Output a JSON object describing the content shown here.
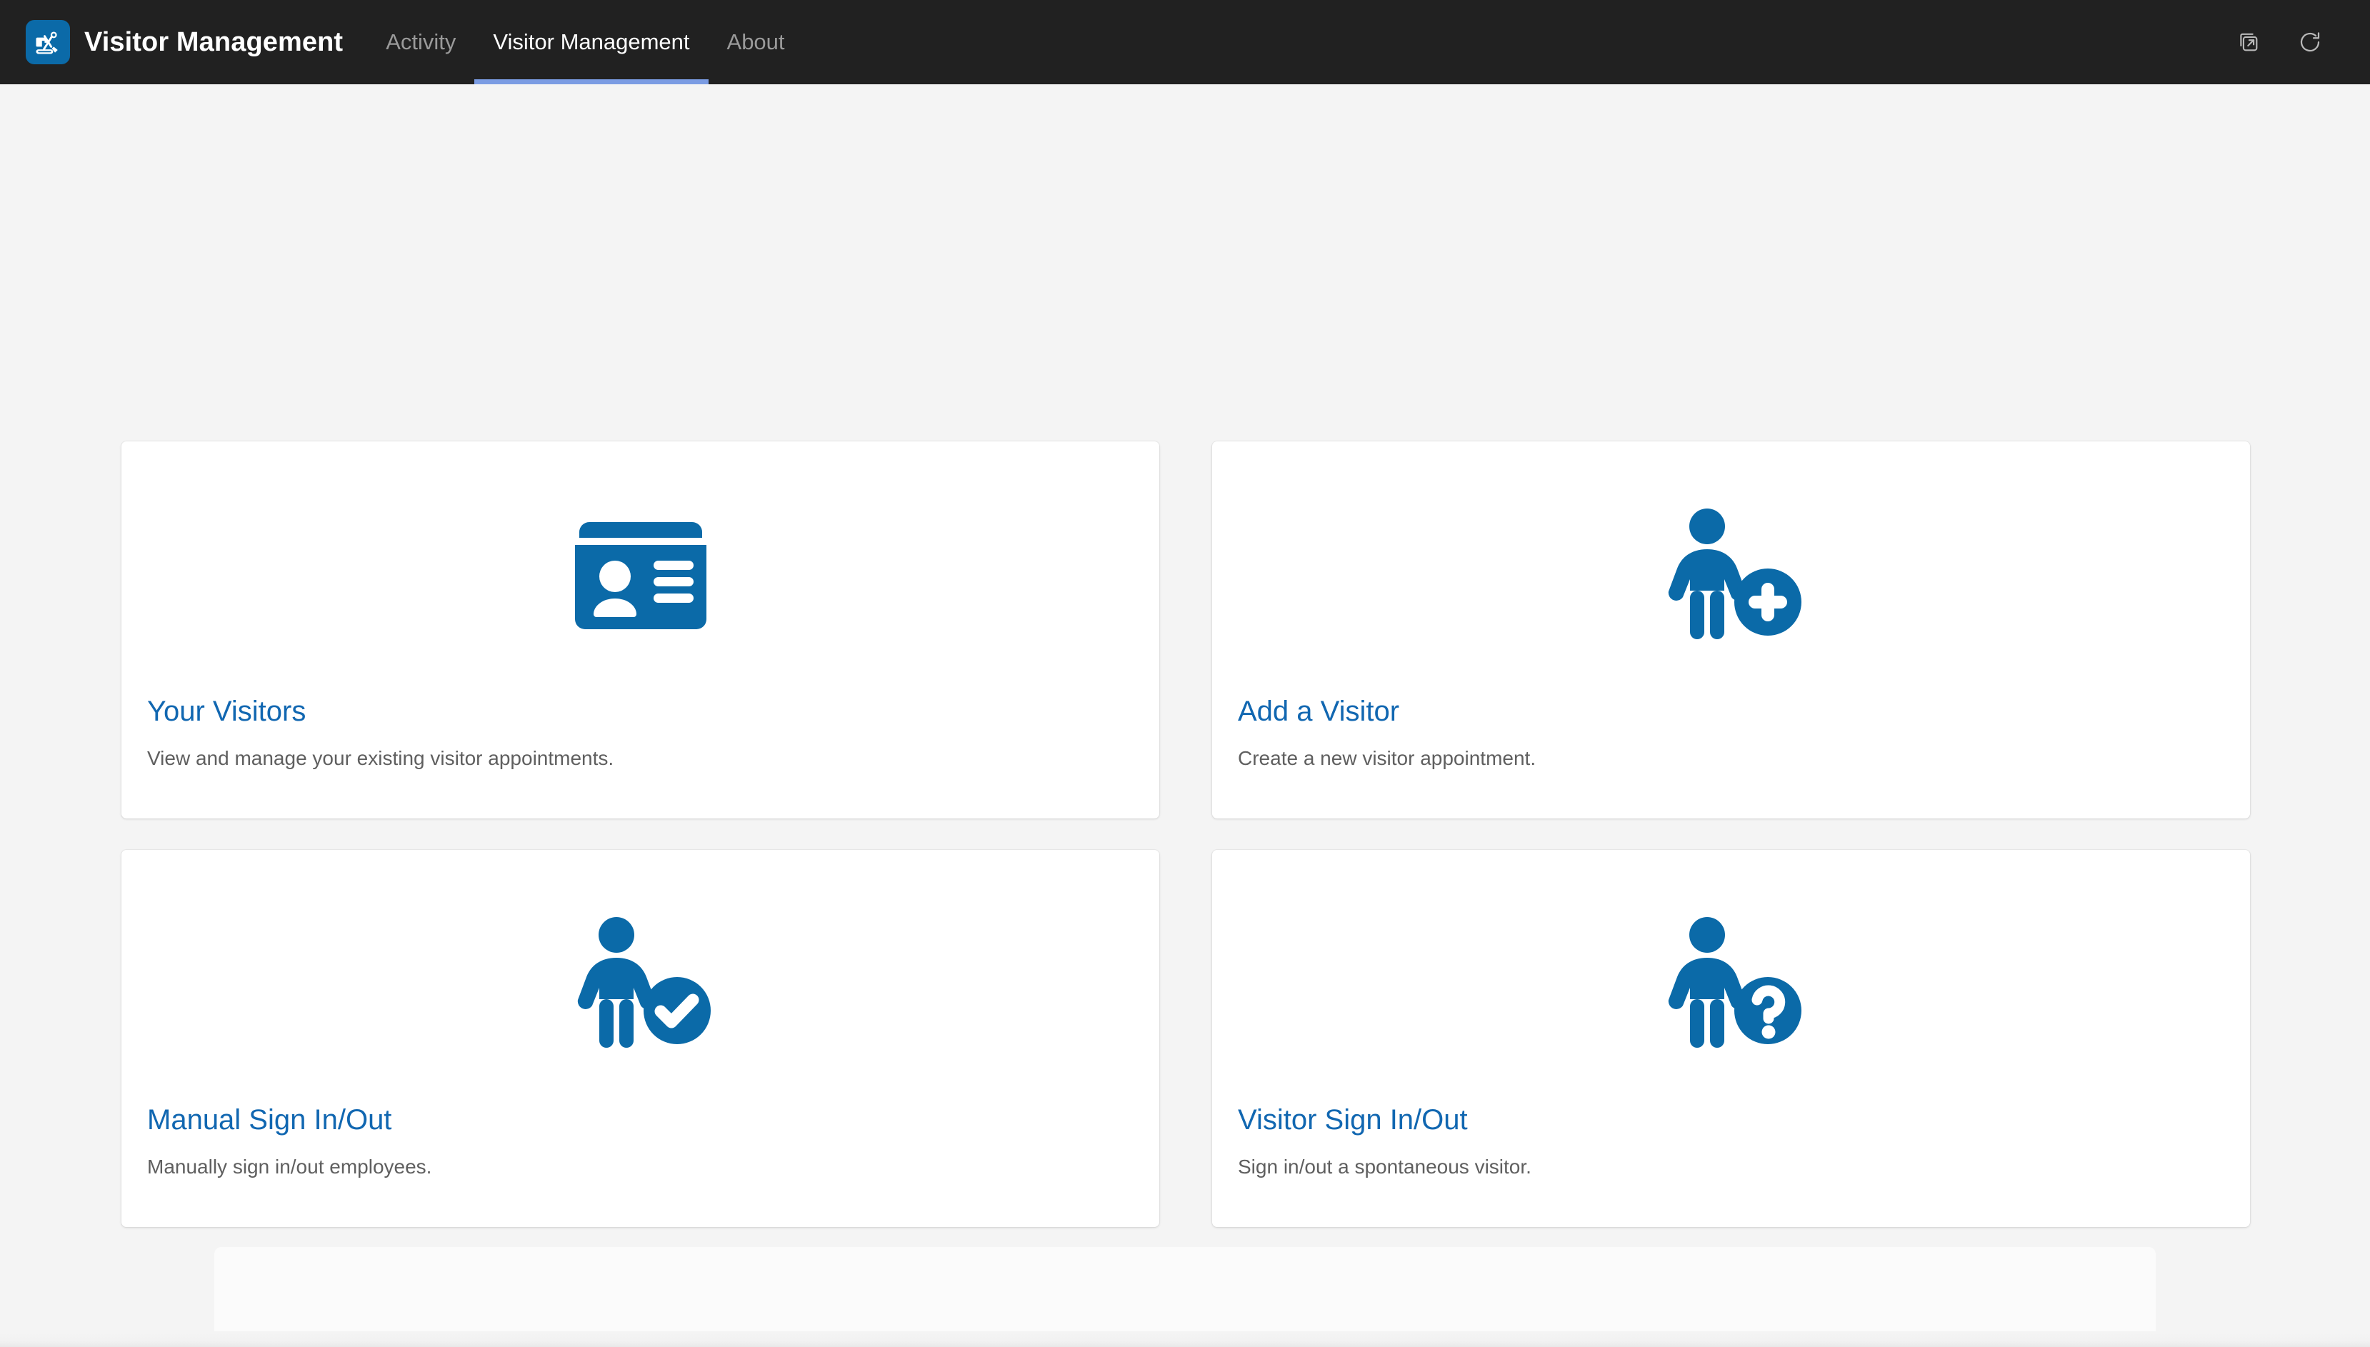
{
  "navbar": {
    "logo_icon": "excavator-tools-logo-icon",
    "brand_title": "Visitor Management",
    "items": [
      {
        "label": "Activity",
        "active": false
      },
      {
        "label": "Visitor Management",
        "active": true
      },
      {
        "label": "About",
        "active": false
      }
    ],
    "actions": [
      {
        "name": "open-in-new-window-icon",
        "label": "Open in new window"
      },
      {
        "name": "refresh-icon",
        "label": "Refresh"
      }
    ],
    "colors": {
      "background": "#212121",
      "brand_logo_background": "#0b6aa8",
      "active_underline": "#7b9ce3",
      "active_text": "#ffffff",
      "inactive_text": "#9a9a9a"
    }
  },
  "page": {
    "background": "#f4f4f4",
    "accent": "#1167b1",
    "icon_blue": "#0b6aa8"
  },
  "cards": [
    {
      "icon": "id-card-icon",
      "title": "Your Visitors",
      "description": "View and manage your existing visitor appointments."
    },
    {
      "icon": "person-add-icon",
      "title": "Add a Visitor",
      "description": "Create a new visitor appointment."
    },
    {
      "icon": "person-check-icon",
      "title": "Manual Sign In/Out",
      "description": "Manually sign in/out employees."
    },
    {
      "icon": "person-question-icon",
      "title": "Visitor Sign In/Out",
      "description": "Sign in/out a spontaneous visitor."
    }
  ]
}
